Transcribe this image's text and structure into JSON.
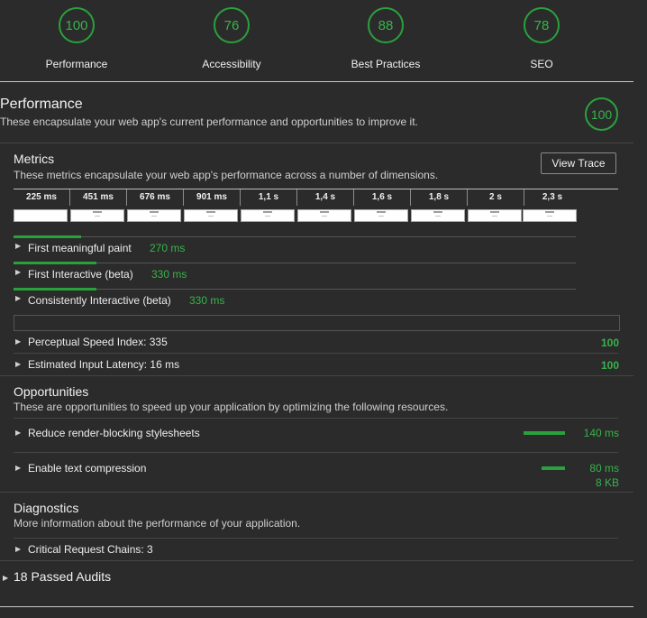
{
  "categories": [
    {
      "score": "100",
      "label": "Performance"
    },
    {
      "score": "76",
      "label": "Accessibility"
    },
    {
      "score": "88",
      "label": "Best Practices"
    },
    {
      "score": "78",
      "label": "SEO"
    }
  ],
  "performance": {
    "title": "Performance",
    "description": "These encapsulate your web app's current performance and opportunities to improve it.",
    "score": "100"
  },
  "metrics": {
    "title": "Metrics",
    "description": "These metrics encapsulate your web app's performance across a number of dimensions.",
    "view_trace_label": "View Trace",
    "filmstrip": [
      "225 ms",
      "451 ms",
      "676 ms",
      "901 ms",
      "1,1 s",
      "1,4 s",
      "1,6 s",
      "1,8 s",
      "2 s",
      "2,3 s"
    ],
    "timed": [
      {
        "label": "First meaningful paint",
        "value": "270 ms",
        "bar_fraction": 0.12
      },
      {
        "label": "First Interactive (beta)",
        "value": "330 ms",
        "bar_fraction": 0.148
      },
      {
        "label": "Consistently Interactive (beta)",
        "value": "330 ms",
        "bar_fraction": 0.148
      }
    ],
    "scored": [
      {
        "label": "Perceptual Speed Index: 335",
        "score": "100"
      },
      {
        "label": "Estimated Input Latency: 16 ms",
        "score": "100"
      }
    ]
  },
  "opportunities": {
    "title": "Opportunities",
    "description": "These are opportunities to speed up your application by optimizing the following resources.",
    "items": [
      {
        "label": "Reduce render-blocking stylesheets",
        "value": "140 ms",
        "detail": "",
        "bar_fraction": 1.0
      },
      {
        "label": "Enable text compression",
        "value": "80 ms",
        "detail": "8 KB",
        "bar_fraction": 0.57
      }
    ]
  },
  "diagnostics": {
    "title": "Diagnostics",
    "description": "More information about the performance of your application.",
    "items": [
      {
        "label": "Critical Request Chains: 3"
      }
    ]
  },
  "passed": {
    "label": "18 Passed Audits"
  },
  "colors": {
    "pass_green": "#2aa13d",
    "background": "#2b2b2b"
  },
  "icons": {
    "expand": "triangle-right-icon"
  }
}
